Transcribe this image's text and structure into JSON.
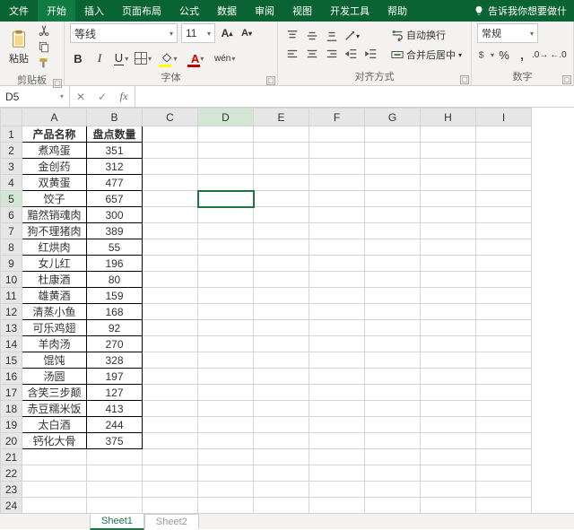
{
  "tabs": {
    "file": "文件",
    "home": "开始",
    "insert": "插入",
    "layout": "页面布局",
    "formulas": "公式",
    "data": "数据",
    "review": "审阅",
    "view": "视图",
    "dev": "开发工具",
    "help": "帮助",
    "tell_me": "告诉我你想要做什"
  },
  "ribbon": {
    "clipboard_label": "剪贴板",
    "paste": "粘贴",
    "font_label": "字体",
    "font_name": "等线",
    "font_size": "11",
    "align_label": "对齐方式",
    "wrap": "自动换行",
    "merge": "合并后居中",
    "number_label": "数字",
    "number_format": "常规"
  },
  "fx": {
    "cell": "D5",
    "formula": ""
  },
  "columns": [
    "A",
    "B",
    "C",
    "D",
    "E",
    "F",
    "G",
    "H",
    "I"
  ],
  "headers": {
    "a": "产品名称",
    "b": "盘点数量"
  },
  "rows": [
    {
      "a": "煮鸡蛋",
      "b": "351"
    },
    {
      "a": "金创药",
      "b": "312"
    },
    {
      "a": "双黄蛋",
      "b": "477"
    },
    {
      "a": "饺子",
      "b": "657"
    },
    {
      "a": "黯然销魂肉",
      "b": "300"
    },
    {
      "a": "狗不理猪肉",
      "b": "389"
    },
    {
      "a": "红烘肉",
      "b": "55"
    },
    {
      "a": "女儿红",
      "b": "196"
    },
    {
      "a": "杜康酒",
      "b": "80"
    },
    {
      "a": "雄黄酒",
      "b": "159"
    },
    {
      "a": "清蒸小鱼",
      "b": "168"
    },
    {
      "a": "可乐鸡翅",
      "b": "92"
    },
    {
      "a": "羊肉汤",
      "b": "270"
    },
    {
      "a": "馄饨",
      "b": "328"
    },
    {
      "a": "汤圆",
      "b": "197"
    },
    {
      "a": "含笑三步颠",
      "b": "127"
    },
    {
      "a": "赤豆糯米饭",
      "b": "413"
    },
    {
      "a": "太白酒",
      "b": "244"
    },
    {
      "a": "钙化大骨",
      "b": "375"
    }
  ],
  "blank_rows": 4,
  "sheets": {
    "s1": "Sheet1",
    "s2": "Sheet2"
  },
  "selected_cell": "D5"
}
